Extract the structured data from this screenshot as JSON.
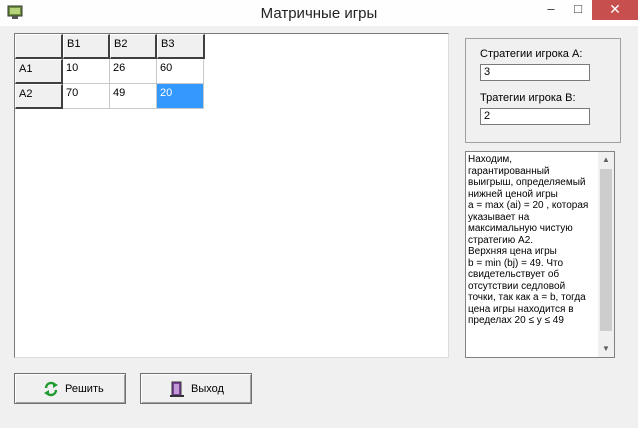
{
  "window": {
    "title": "Матричные игры",
    "minimize": "–",
    "maximize": "□",
    "close": "✕"
  },
  "grid": {
    "header_row": [
      "",
      "B1",
      "B2",
      "B3"
    ],
    "rows": [
      {
        "label": "A1",
        "cells": [
          "10",
          "26",
          "60"
        ]
      },
      {
        "label": "A2",
        "cells": [
          "70",
          "49",
          "20"
        ]
      }
    ]
  },
  "group": {
    "label_a": "Стратегии игрока А:",
    "value_a": "3",
    "label_b": "Тратегии игрока В:",
    "value_b": "2"
  },
  "memo": {
    "text": "Находим,\nгарантированный\nвыигрыш, определяемый\nнижней ценой игры\na = max (ai) = 20 , которая\nуказывает на\nмаксимальную чистую\nстратегию A2.\nВерхняя цена игры\nb = min (bj) = 49. Что\nсвидетельствует об\nотсутствии седловой\nточки, так как a = b, тогда\nцена игры находится в\nпределах 20 ≤ y ≤ 49",
    "scroll_up": "▲",
    "scroll_down": "▼"
  },
  "buttons": {
    "solve": "Решить",
    "exit": "Выход"
  },
  "colors": {
    "selection": "#3399ff",
    "close": "#c7504f"
  },
  "icons": {
    "app": "app-icon",
    "solve": "refresh-icon",
    "exit": "door-icon"
  }
}
